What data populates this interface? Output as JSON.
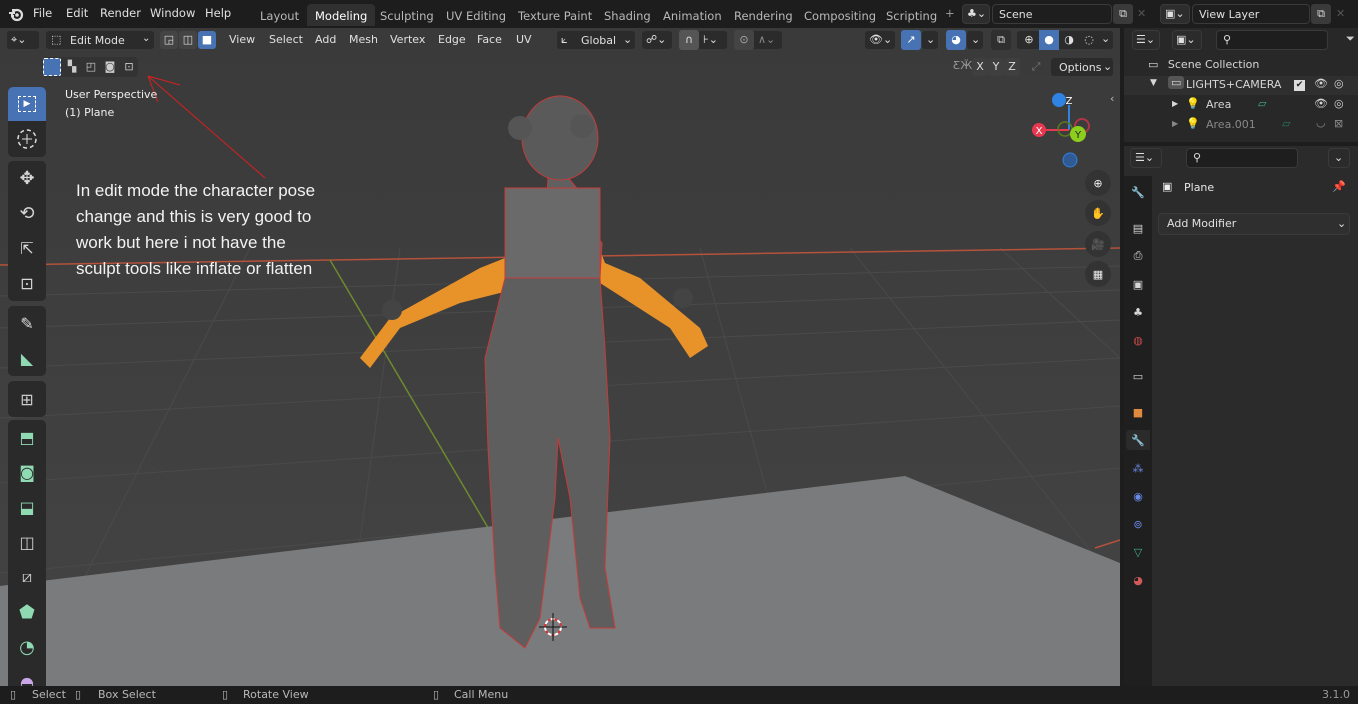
{
  "app": {
    "name": "Blender",
    "version": "3.1.0"
  },
  "topbar": {
    "menus": [
      "File",
      "Edit",
      "Render",
      "Window",
      "Help"
    ],
    "workspace_tabs": [
      "Layout",
      "Modeling",
      "Sculpting",
      "UV Editing",
      "Texture Paint",
      "Shading",
      "Animation",
      "Rendering",
      "Compositing",
      "Scripting"
    ],
    "active_workspace": "Modeling",
    "add_tab_symbol": "+",
    "scene": "Scene",
    "view_layer": "View Layer"
  },
  "viewport_header": {
    "mode": "Edit Mode",
    "menus": [
      "View",
      "Select",
      "Add",
      "Mesh",
      "Vertex",
      "Edge",
      "Face",
      "UV"
    ],
    "transform_orientation": "Global",
    "mirror_axes": [
      "X",
      "Y",
      "Z"
    ],
    "options_label": "Options"
  },
  "viewport": {
    "view_name": "User Perspective",
    "object_info": "(1) Plane",
    "gizmo_axes": {
      "z": "Z",
      "x": "X",
      "y": "Y"
    },
    "annotation": [
      "In edit mode the character pose",
      "change and this is very good to",
      "work but here i not have the",
      "sculpt tools like inflate or flatten"
    ]
  },
  "outliner": {
    "root": "Scene Collection",
    "items": [
      {
        "name": "LIGHTS+CAMERA",
        "type": "collection",
        "visible": true,
        "checked": true
      },
      {
        "name": "Area",
        "type": "light",
        "visible": true
      },
      {
        "name": "Area.001",
        "type": "light",
        "visible": false
      }
    ]
  },
  "properties": {
    "object_name": "Plane",
    "add_modifier_label": "Add Modifier",
    "active_tab": "modifiers"
  },
  "statusbar": {
    "hints": [
      "Select",
      "Box Select",
      "Rotate View",
      "Call Menu"
    ],
    "version": "3.1.0"
  },
  "colors": {
    "accent": "#4772b3",
    "axis_x": "#e8384f",
    "axis_y": "#8cce1c",
    "axis_z": "#2f83e2",
    "selection": "#f59a1f"
  }
}
